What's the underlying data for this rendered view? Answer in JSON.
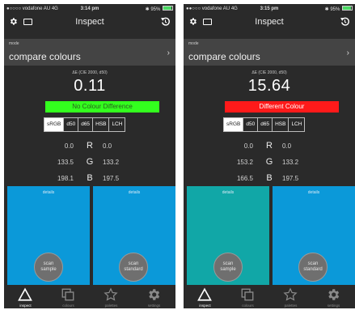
{
  "colors": {
    "screen_bg": "#2a2a2a",
    "mode_panel_bg": "#444444",
    "no_difference": "#33ff1e",
    "different": "#ff1a1a",
    "swatch_blue": "#0b99d9",
    "swatch_teal": "#11a7a7"
  },
  "screens": [
    {
      "status": {
        "carrier": "●○○○○ vodafone AU  4G",
        "time": "3:14 pm",
        "right": "✱ 95%"
      },
      "nav": {
        "title": "Inspect"
      },
      "mode": {
        "caption": "mode",
        "value": "compare colours",
        "chevron": "›"
      },
      "delta": {
        "caption": "ΔE (CIE 2000, d50)",
        "value": "0.11"
      },
      "verdict": {
        "text": "No Colour Difference",
        "color": "#33ff1e"
      },
      "spaces": [
        "sRGB",
        "d50",
        "d65",
        "HSB",
        "LCH"
      ],
      "active_space": "sRGB",
      "rows": [
        {
          "letter": "R",
          "sample": "0.0",
          "standard": "0.0"
        },
        {
          "letter": "G",
          "sample": "133.5",
          "standard": "133.2"
        },
        {
          "letter": "B",
          "sample": "198.1",
          "standard": "197.5"
        }
      ],
      "sample": {
        "caption": "details",
        "button_line1": "scan",
        "button_line2": "sample",
        "color": "#0b99d9"
      },
      "standard": {
        "caption": "details",
        "button_line1": "scan",
        "button_line2": "standard",
        "color": "#0b99d9"
      },
      "tabs": [
        {
          "label": "inspect",
          "icon": "triangle-icon",
          "active": true
        },
        {
          "label": "colours",
          "icon": "stacked-squares-icon",
          "active": false
        },
        {
          "label": "palettes",
          "icon": "star-icon",
          "active": false
        },
        {
          "label": "settings",
          "icon": "gear-icon",
          "active": false
        }
      ]
    },
    {
      "status": {
        "carrier": "●●○○○ vodafone AU  4G",
        "time": "3:15 pm",
        "right": "✱ 95%"
      },
      "nav": {
        "title": "Inspect"
      },
      "mode": {
        "caption": "mode",
        "value": "compare colours",
        "chevron": "›"
      },
      "delta": {
        "caption": "ΔE (CIE 2000, d50)",
        "value": "15.64"
      },
      "verdict": {
        "text": "Different Colour",
        "color": "#ff1a1a"
      },
      "spaces": [
        "sRGB",
        "d50",
        "d65",
        "HSB",
        "LCH"
      ],
      "active_space": "sRGB",
      "rows": [
        {
          "letter": "R",
          "sample": "0.0",
          "standard": "0.0"
        },
        {
          "letter": "G",
          "sample": "153.2",
          "standard": "133.2"
        },
        {
          "letter": "B",
          "sample": "166.5",
          "standard": "197.5"
        }
      ],
      "sample": {
        "caption": "details",
        "button_line1": "scan",
        "button_line2": "sample",
        "color": "#11a7a7"
      },
      "standard": {
        "caption": "details",
        "button_line1": "scan",
        "button_line2": "standard",
        "color": "#0b99d9"
      },
      "tabs": [
        {
          "label": "inspect",
          "icon": "triangle-icon",
          "active": true
        },
        {
          "label": "colours",
          "icon": "stacked-squares-icon",
          "active": false
        },
        {
          "label": "palettes",
          "icon": "star-icon",
          "active": false
        },
        {
          "label": "settings",
          "icon": "gear-icon",
          "active": false
        }
      ]
    }
  ]
}
